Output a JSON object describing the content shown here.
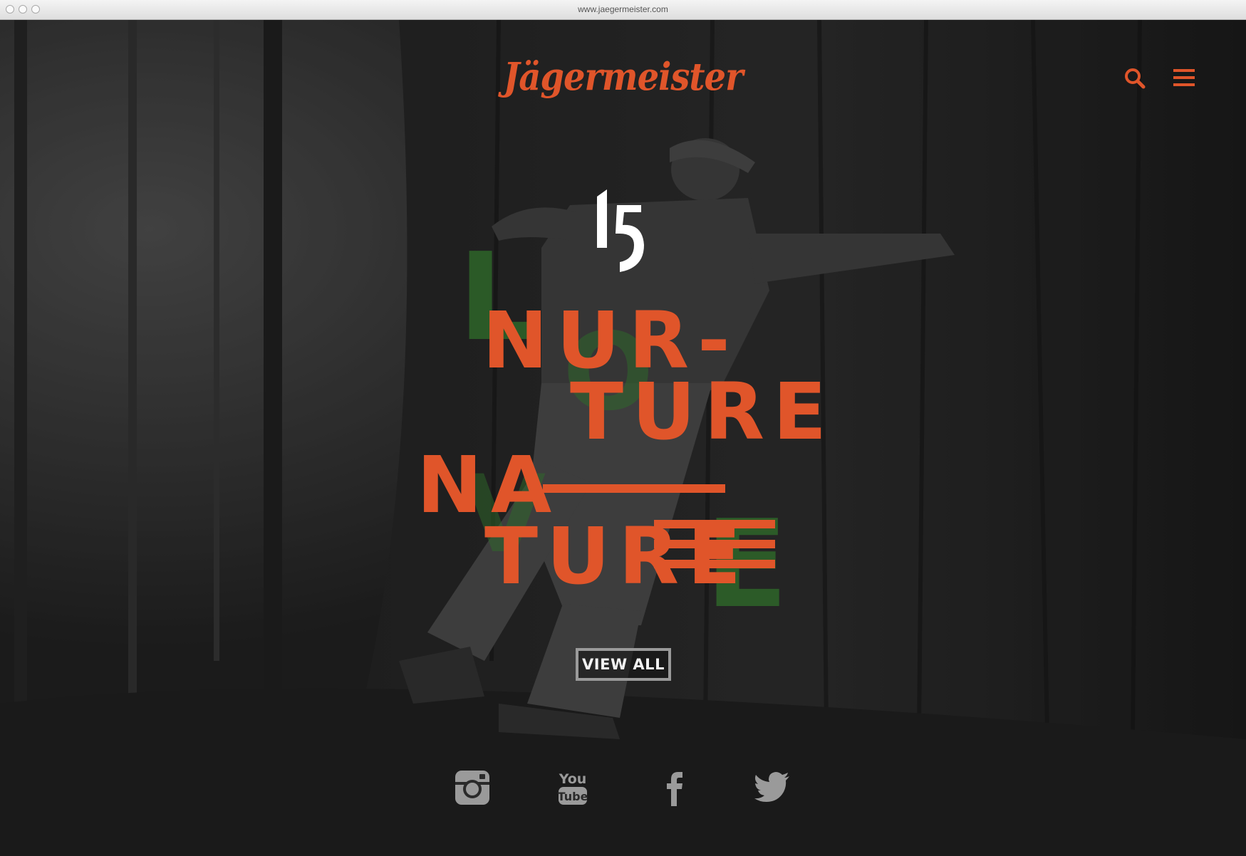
{
  "browser": {
    "url": "www.jaegermeister.com"
  },
  "header": {
    "logo_text": "Jägermeister",
    "search_icon": "search-icon",
    "menu_icon": "hamburger-menu-icon"
  },
  "hero": {
    "number": "15",
    "background_word": [
      "L",
      "O",
      "V",
      "E"
    ],
    "headline_lines": [
      "NUR-",
      "TURE",
      "NA",
      "TURE"
    ],
    "cta_label": "VIEW ALL"
  },
  "social": [
    {
      "name": "instagram-icon",
      "label": "Instagram"
    },
    {
      "name": "youtube-icon",
      "label": "You Tube"
    },
    {
      "name": "facebook-icon",
      "label": "f"
    },
    {
      "name": "twitter-icon",
      "label": "Twitter"
    }
  ],
  "colors": {
    "accent": "#e0552a",
    "love_green": "#2f6b2a",
    "icon_grey": "#9a9a9a"
  }
}
